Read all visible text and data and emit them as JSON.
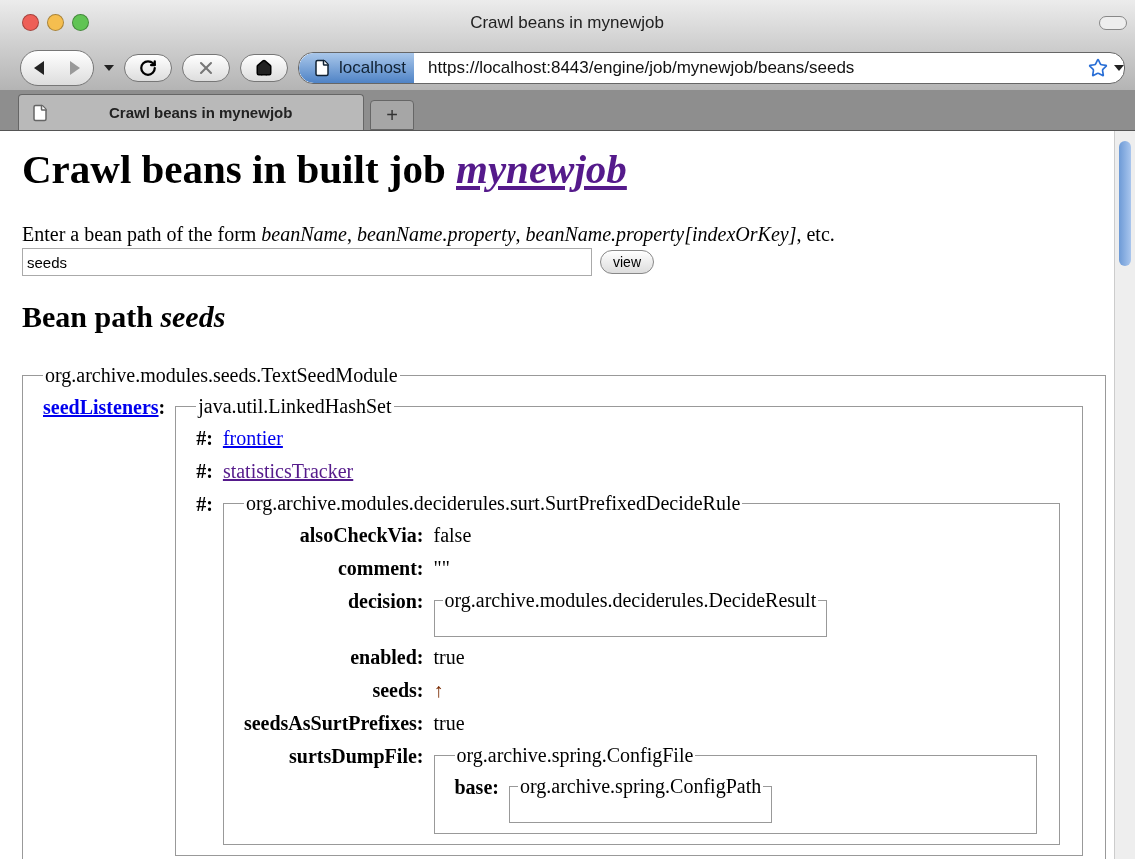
{
  "window": {
    "title": "Crawl beans in mynewjob"
  },
  "address_bar": {
    "site": "localhost",
    "url": "https://localhost:8443/engine/job/mynewjob/beans/seeds"
  },
  "tabs": [
    {
      "label": "Crawl beans in mynewjob",
      "selected": true
    }
  ],
  "new_tab": "+",
  "page": {
    "heading": "Crawl beans in built job",
    "heading_link": {
      "text": "mynewjob",
      "visited": true
    },
    "intro": "Enter a bean path of the form *beanName*, *beanName.property*, *beanName.property[indexOrKey]*, etc.",
    "path_field": {
      "value": "seeds"
    },
    "view_button": "view",
    "subheading": "Bean path *seeds*",
    "bean": {
      "class": "org.archive.modules.seeds.TextSeedModule",
      "entries": [
        {
          "label": "seedListeners",
          "link": true,
          "visited": false,
          "after": ":",
          "kind": "object",
          "class": "java.util.LinkedHashSet",
          "entries": [
            {
              "label": "#:",
              "kind": "link",
              "value": "frontier",
              "visited": false
            },
            {
              "label": "#:",
              "kind": "link",
              "value": "statisticsTracker",
              "visited": true
            },
            {
              "label": "#:",
              "kind": "object",
              "class": "org.archive.modules.deciderules.surt.SurtPrefixedDecideRule",
              "entries": [
                {
                  "label": "alsoCheckVia:",
                  "kind": "text",
                  "value": "false"
                },
                {
                  "label": "comment:",
                  "kind": "text",
                  "value": "\"\""
                },
                {
                  "label": "decision:",
                  "kind": "object",
                  "class": "org.archive.modules.deciderules.DecideResult"
                },
                {
                  "label": "enabled:",
                  "kind": "text",
                  "value": "true"
                },
                {
                  "label": "seeds:",
                  "kind": "ref",
                  "value": "↑"
                },
                {
                  "label": "seedsAsSurtPrefixes:",
                  "kind": "text",
                  "value": "true"
                },
                {
                  "label": "surtsDumpFile:",
                  "kind": "object",
                  "class": "org.archive.spring.ConfigFile",
                  "entries": [
                    {
                      "label": "base:",
                      "kind": "object",
                      "class": "org.archive.spring.ConfigPath"
                    }
                  ]
                }
              ]
            }
          ]
        }
      ]
    }
  }
}
